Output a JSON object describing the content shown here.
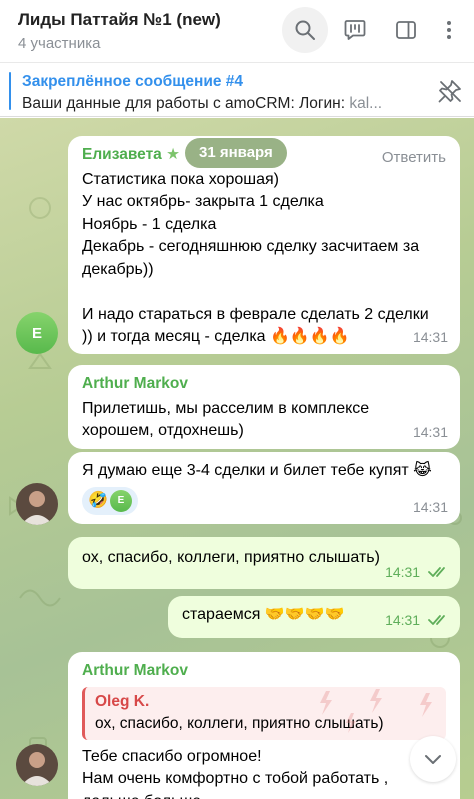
{
  "header": {
    "title": "Лиды Паттайя №1 (new)",
    "subtitle": "4 участника"
  },
  "pinned": {
    "title": "Закреплённое сообщение #4",
    "text": "Ваши данные для работы с amoCRM: Логин: ",
    "text_muted": "kal..."
  },
  "date_pill": "31 января",
  "messages": [
    {
      "sender": "Елизавета",
      "sender_color": "#4fae4e",
      "reply_label": "Ответить",
      "lines": [
        "Статистика пока хорошая)",
        "У нас октябрь- закрыта 1 сделка",
        "Ноябрь - 1 сделка",
        "Декабрь - сегодняшнюю сделку засчитаем за",
        "декабрь))",
        "",
        "И надо стараться в феврале сделать 2 сделки",
        ")) и тогда месяц - сделка 🔥🔥🔥🔥"
      ],
      "time": "14:31",
      "avatar_letter": "E"
    },
    {
      "sender": "Arthur Markov",
      "sender_color": "#4fae4e",
      "lines": [
        "Прилетишь, мы расселим в комплексе",
        "хорошем, отдохнешь)"
      ],
      "time": "14:31"
    },
    {
      "text": "Я думаю еще 3-4 сделки и билет тебе купят 😹",
      "reaction_emoji": "🤣",
      "reaction_avatar": "E",
      "time": "14:31"
    },
    {
      "text": "ох, спасибо, коллеги, приятно слышать)",
      "time": "14:31"
    },
    {
      "text": "стараемся 🤝🤝🤝🤝",
      "time": "14:31"
    },
    {
      "sender": "Arthur Markov",
      "sender_color": "#4fae4e",
      "quote_name": "Oleg K.",
      "quote_text": "ох, спасибо, коллеги, приятно слышать)",
      "lines": [
        "Тебе спасибо огромное!",
        "Нам очень комфортно с тобой работать ,",
        "дальше больше"
      ]
    }
  ],
  "colors": {
    "accent": "#3390ec",
    "outgoing_bg": "#effedd",
    "check": "#5fae5a",
    "quote_accent": "#e05a5a"
  },
  "icons": [
    "search-icon",
    "poll-icon",
    "sidebar-icon",
    "more-vertical-icon",
    "unpin-icon",
    "double-check-icon",
    "chevron-down-icon"
  ]
}
